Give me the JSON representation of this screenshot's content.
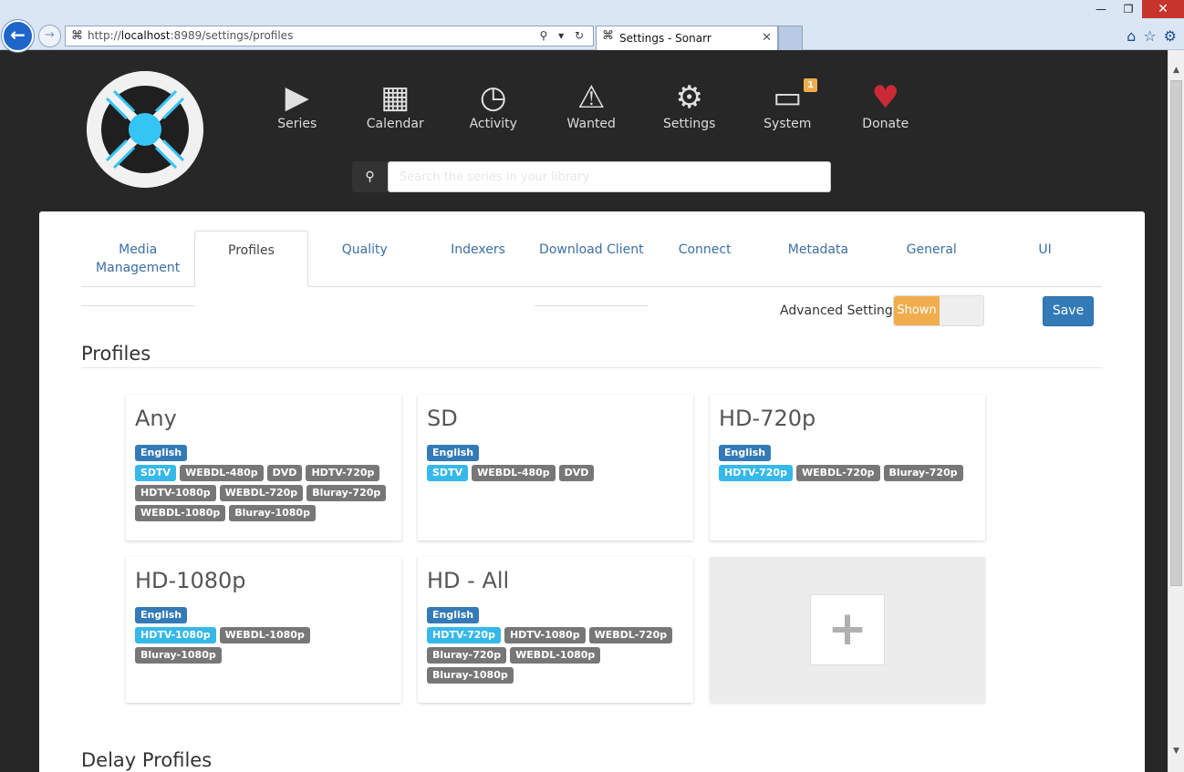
{
  "browser": {
    "url_prefix": "http://",
    "url_host": "localhost",
    "url_rest": ":8989/settings/profiles",
    "tab_title": "Settings - Sonarr",
    "back_glyph": "←",
    "forward_glyph": "→",
    "close_glyph": "✕",
    "min_glyph": "—",
    "restore_glyph": "❐",
    "addr_icons": "⚲ ▾ ↻",
    "tool_icons": [
      "⌂",
      "☆",
      "⚙"
    ]
  },
  "header": {
    "nav": [
      {
        "label": "Series",
        "icon": "play-icon",
        "glyph": "▶"
      },
      {
        "label": "Calendar",
        "icon": "calendar-icon",
        "glyph": "▦"
      },
      {
        "label": "Activity",
        "icon": "clock-icon",
        "glyph": "◷"
      },
      {
        "label": "Wanted",
        "icon": "warning-icon",
        "glyph": "⚠"
      },
      {
        "label": "Settings",
        "icon": "gears-icon",
        "glyph": "⚙"
      },
      {
        "label": "System",
        "icon": "laptop-icon",
        "glyph": "▭"
      },
      {
        "label": "Donate",
        "icon": "heart-icon",
        "glyph": "♥"
      }
    ],
    "system_badge": "1",
    "search_placeholder": "Search the series in your library",
    "search_glyph": "⚲"
  },
  "settings_tabs": [
    {
      "label": "Media Management"
    },
    {
      "label": "Profiles"
    },
    {
      "label": "Quality"
    },
    {
      "label": "Indexers"
    },
    {
      "label": "Download Client"
    },
    {
      "label": "Connect"
    },
    {
      "label": "Metadata"
    },
    {
      "label": "General"
    },
    {
      "label": "UI"
    }
  ],
  "advanced": {
    "label": "Advanced Settings",
    "state": "Shown"
  },
  "save_label": "Save",
  "profiles_title": "Profiles",
  "delay_title": "Delay Profiles",
  "profiles": [
    {
      "name": "Any",
      "language": "English",
      "cutoff": "SDTV",
      "qualities": [
        "SDTV",
        "WEBDL-480p",
        "DVD",
        "HDTV-720p",
        "HDTV-1080p",
        "WEBDL-720p",
        "Bluray-720p",
        "WEBDL-1080p",
        "Bluray-1080p"
      ]
    },
    {
      "name": "SD",
      "language": "English",
      "cutoff": "SDTV",
      "qualities": [
        "SDTV",
        "WEBDL-480p",
        "DVD"
      ]
    },
    {
      "name": "HD-720p",
      "language": "English",
      "cutoff": "HDTV-720p",
      "qualities": [
        "HDTV-720p",
        "WEBDL-720p",
        "Bluray-720p"
      ]
    },
    {
      "name": "HD-1080p",
      "language": "English",
      "cutoff": "HDTV-1080p",
      "qualities": [
        "HDTV-1080p",
        "WEBDL-1080p",
        "Bluray-1080p"
      ]
    },
    {
      "name": "HD - All",
      "language": "English",
      "cutoff": "HDTV-720p",
      "qualities": [
        "HDTV-720p",
        "HDTV-1080p",
        "WEBDL-720p",
        "Bluray-720p",
        "WEBDL-1080p",
        "Bluray-1080p"
      ]
    }
  ],
  "add_glyph": "+",
  "colors": {
    "accent": "#337ab7",
    "cutoff": "#36b8e8",
    "warning": "#f0ad4e",
    "donate": "#cc2936",
    "header_bg": "#272727"
  }
}
